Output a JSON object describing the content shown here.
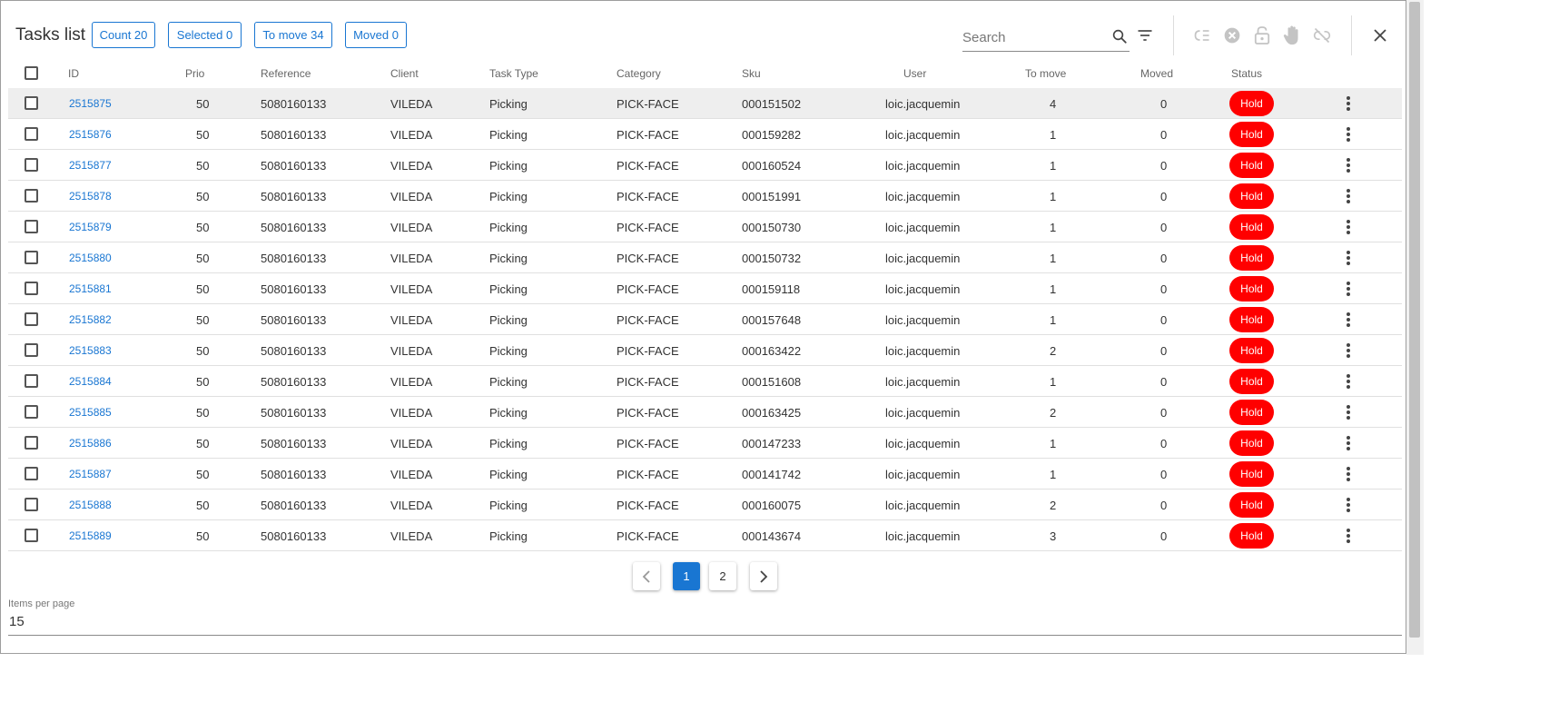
{
  "header": {
    "title": "Tasks list",
    "chips": {
      "count": "Count 20",
      "selected": "Selected 0",
      "to_move": "To move 34",
      "moved": "Moved 0"
    },
    "search_placeholder": "Search"
  },
  "toolbar_icons": [
    "search-icon",
    "filter-icon",
    "list-icon",
    "cancel-circle-icon",
    "unlock-icon",
    "hand-icon",
    "unlink-icon",
    "close-icon"
  ],
  "columns": {
    "id": "ID",
    "prio": "Prio",
    "reference": "Reference",
    "client": "Client",
    "task_type": "Task Type",
    "category": "Category",
    "sku": "Sku",
    "user": "User",
    "to_move": "To move",
    "moved": "Moved",
    "status": "Status"
  },
  "rows": [
    {
      "id": "2515875",
      "prio": "50",
      "reference": "5080160133",
      "client": "VILEDA",
      "task_type": "Picking",
      "category": "PICK-FACE",
      "sku": "000151502",
      "user": "loic.jacquemin",
      "to_move": "4",
      "moved": "0",
      "status": "Hold"
    },
    {
      "id": "2515876",
      "prio": "50",
      "reference": "5080160133",
      "client": "VILEDA",
      "task_type": "Picking",
      "category": "PICK-FACE",
      "sku": "000159282",
      "user": "loic.jacquemin",
      "to_move": "1",
      "moved": "0",
      "status": "Hold"
    },
    {
      "id": "2515877",
      "prio": "50",
      "reference": "5080160133",
      "client": "VILEDA",
      "task_type": "Picking",
      "category": "PICK-FACE",
      "sku": "000160524",
      "user": "loic.jacquemin",
      "to_move": "1",
      "moved": "0",
      "status": "Hold"
    },
    {
      "id": "2515878",
      "prio": "50",
      "reference": "5080160133",
      "client": "VILEDA",
      "task_type": "Picking",
      "category": "PICK-FACE",
      "sku": "000151991",
      "user": "loic.jacquemin",
      "to_move": "1",
      "moved": "0",
      "status": "Hold"
    },
    {
      "id": "2515879",
      "prio": "50",
      "reference": "5080160133",
      "client": "VILEDA",
      "task_type": "Picking",
      "category": "PICK-FACE",
      "sku": "000150730",
      "user": "loic.jacquemin",
      "to_move": "1",
      "moved": "0",
      "status": "Hold"
    },
    {
      "id": "2515880",
      "prio": "50",
      "reference": "5080160133",
      "client": "VILEDA",
      "task_type": "Picking",
      "category": "PICK-FACE",
      "sku": "000150732",
      "user": "loic.jacquemin",
      "to_move": "1",
      "moved": "0",
      "status": "Hold"
    },
    {
      "id": "2515881",
      "prio": "50",
      "reference": "5080160133",
      "client": "VILEDA",
      "task_type": "Picking",
      "category": "PICK-FACE",
      "sku": "000159118",
      "user": "loic.jacquemin",
      "to_move": "1",
      "moved": "0",
      "status": "Hold"
    },
    {
      "id": "2515882",
      "prio": "50",
      "reference": "5080160133",
      "client": "VILEDA",
      "task_type": "Picking",
      "category": "PICK-FACE",
      "sku": "000157648",
      "user": "loic.jacquemin",
      "to_move": "1",
      "moved": "0",
      "status": "Hold"
    },
    {
      "id": "2515883",
      "prio": "50",
      "reference": "5080160133",
      "client": "VILEDA",
      "task_type": "Picking",
      "category": "PICK-FACE",
      "sku": "000163422",
      "user": "loic.jacquemin",
      "to_move": "2",
      "moved": "0",
      "status": "Hold"
    },
    {
      "id": "2515884",
      "prio": "50",
      "reference": "5080160133",
      "client": "VILEDA",
      "task_type": "Picking",
      "category": "PICK-FACE",
      "sku": "000151608",
      "user": "loic.jacquemin",
      "to_move": "1",
      "moved": "0",
      "status": "Hold"
    },
    {
      "id": "2515885",
      "prio": "50",
      "reference": "5080160133",
      "client": "VILEDA",
      "task_type": "Picking",
      "category": "PICK-FACE",
      "sku": "000163425",
      "user": "loic.jacquemin",
      "to_move": "2",
      "moved": "0",
      "status": "Hold"
    },
    {
      "id": "2515886",
      "prio": "50",
      "reference": "5080160133",
      "client": "VILEDA",
      "task_type": "Picking",
      "category": "PICK-FACE",
      "sku": "000147233",
      "user": "loic.jacquemin",
      "to_move": "1",
      "moved": "0",
      "status": "Hold"
    },
    {
      "id": "2515887",
      "prio": "50",
      "reference": "5080160133",
      "client": "VILEDA",
      "task_type": "Picking",
      "category": "PICK-FACE",
      "sku": "000141742",
      "user": "loic.jacquemin",
      "to_move": "1",
      "moved": "0",
      "status": "Hold"
    },
    {
      "id": "2515888",
      "prio": "50",
      "reference": "5080160133",
      "client": "VILEDA",
      "task_type": "Picking",
      "category": "PICK-FACE",
      "sku": "000160075",
      "user": "loic.jacquemin",
      "to_move": "2",
      "moved": "0",
      "status": "Hold"
    },
    {
      "id": "2515889",
      "prio": "50",
      "reference": "5080160133",
      "client": "VILEDA",
      "task_type": "Picking",
      "category": "PICK-FACE",
      "sku": "000143674",
      "user": "loic.jacquemin",
      "to_move": "3",
      "moved": "0",
      "status": "Hold"
    }
  ],
  "pagination": {
    "pages": [
      "1",
      "2"
    ],
    "current": "1"
  },
  "items_per_page": {
    "label": "Items per page",
    "value": "15"
  },
  "colors": {
    "accent": "#1976d2",
    "status_hold": "#ff0000",
    "row_highlight": "#eeeeee"
  }
}
